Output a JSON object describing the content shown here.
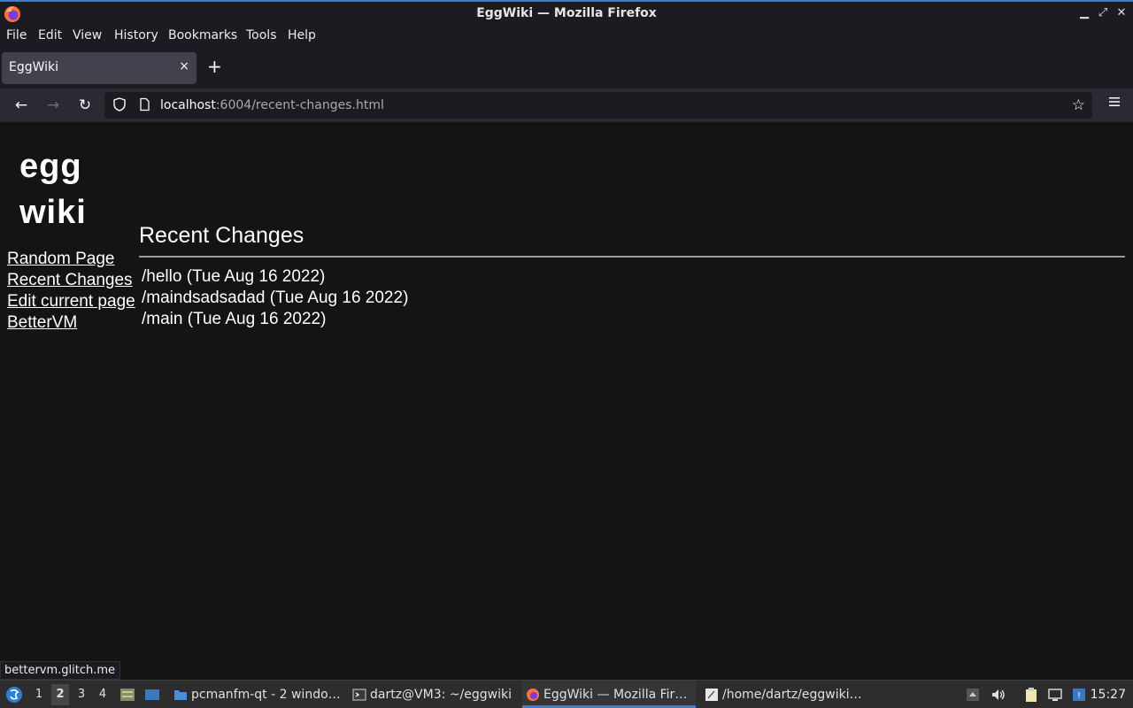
{
  "window": {
    "title": "EggWiki — Mozilla Firefox"
  },
  "menubar": {
    "items": [
      "File",
      "Edit",
      "View",
      "History",
      "Bookmarks",
      "Tools",
      "Help"
    ]
  },
  "tabs": [
    {
      "title": "EggWiki",
      "close": "×"
    }
  ],
  "newtab": "+",
  "urlbar": {
    "host": "localhost",
    "rest": ":6004/recent-changes.html"
  },
  "page": {
    "logo_line1": "egg",
    "logo_line2": "wiki",
    "nav": [
      "Random Page",
      "Recent Changes",
      "Edit current page",
      "BetterVM"
    ],
    "heading": "Recent Changes",
    "changes": [
      "/hello (Tue Aug 16 2022)",
      "/maindsadsadad (Tue Aug 16 2022)",
      "/main (Tue Aug 16 2022)"
    ]
  },
  "status_link": "bettervm.glitch.me",
  "taskbar": {
    "workspaces": [
      "1",
      "2",
      "3",
      "4"
    ],
    "active_workspace": "2",
    "tasks": [
      {
        "label": "pcmanfm-qt - 2 windo…",
        "icon": "folder-icon"
      },
      {
        "label": "dartz@VM3: ~/eggwiki",
        "icon": "terminal-icon"
      },
      {
        "label": "EggWiki — Mozilla Fir…",
        "icon": "firefox-icon"
      },
      {
        "label": "/home/dartz/eggwiki…",
        "icon": "text-editor-icon"
      }
    ],
    "clock": "15:27"
  }
}
